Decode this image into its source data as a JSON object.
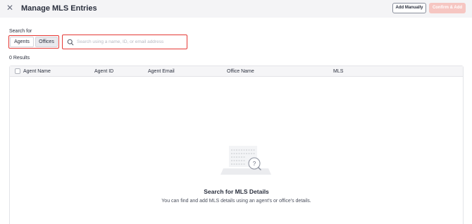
{
  "header": {
    "title": "Manage MLS Entries",
    "close_icon": "close-icon",
    "add_manually_label": "Add Manually",
    "confirm_add_label": "Confirm & Add"
  },
  "search": {
    "label": "Search for",
    "toggles": [
      {
        "label": "Agents",
        "selected": false
      },
      {
        "label": "Offices",
        "selected": true
      }
    ],
    "placeholder": "Search using a name, ID, or email address",
    "value": ""
  },
  "results": {
    "count_text": "0 Results"
  },
  "table": {
    "columns": [
      "Agent Name",
      "Agent ID",
      "Agent Email",
      "Office Name",
      "MLS"
    ]
  },
  "empty_state": {
    "icon": "empty-search-illustration",
    "title": "Search for MLS Details",
    "subtitle": "You can find and add MLS details using an agent's or office's details."
  },
  "colors": {
    "accent_disabled": "#f6c6c2",
    "highlight_border": "#e53935",
    "header_bg": "#f4f4f6"
  }
}
